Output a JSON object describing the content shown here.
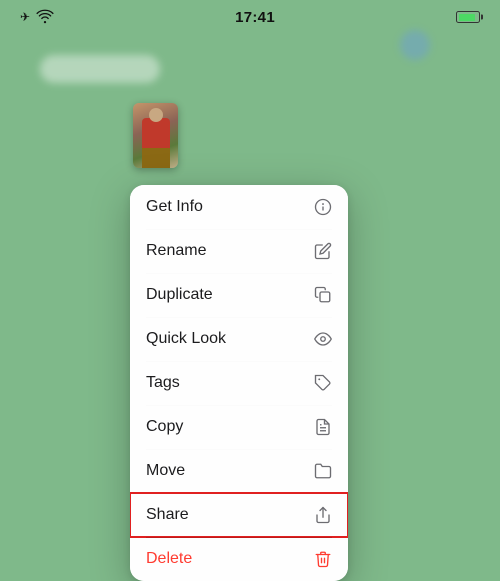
{
  "statusBar": {
    "time": "17:41",
    "batteryColor": "#4cd964"
  },
  "contextMenu": {
    "items": [
      {
        "id": "get-info",
        "label": "Get Info",
        "icon": "info"
      },
      {
        "id": "rename",
        "label": "Rename",
        "icon": "pencil"
      },
      {
        "id": "duplicate",
        "label": "Duplicate",
        "icon": "duplicate"
      },
      {
        "id": "quick-look",
        "label": "Quick Look",
        "icon": "eye"
      },
      {
        "id": "tags",
        "label": "Tags",
        "icon": "tag"
      },
      {
        "id": "copy",
        "label": "Copy",
        "icon": "copy"
      },
      {
        "id": "move",
        "label": "Move",
        "icon": "folder"
      },
      {
        "id": "share",
        "label": "Share",
        "icon": "share",
        "highlighted": true
      },
      {
        "id": "delete",
        "label": "Delete",
        "icon": "trash",
        "destructive": true
      }
    ]
  }
}
